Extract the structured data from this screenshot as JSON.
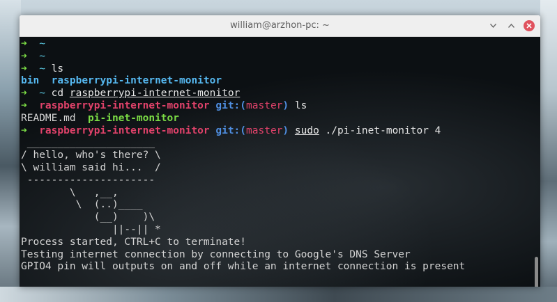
{
  "window": {
    "title": "william@arzhon-pc: ~",
    "controls": {
      "minimize_icon": "chevron-down",
      "maximize_icon": "chevron-up",
      "close_icon": "x"
    }
  },
  "colors": {
    "arrow": "#7bdc45",
    "path": "#5ac8e0",
    "directory": "#56b8f0",
    "executable": "#7bdc45",
    "repo": "#e0426a",
    "git": "#4f8ee0",
    "text": "#d4d4d4",
    "close_button": "#e0525e"
  },
  "terminal": {
    "lines": [
      {
        "segments": [
          {
            "t": "➜  ",
            "c": "arrow"
          },
          {
            "t": "~",
            "c": "tilde"
          }
        ]
      },
      {
        "segments": [
          {
            "t": "➜  ",
            "c": "arrow"
          },
          {
            "t": "~",
            "c": "tilde"
          }
        ]
      },
      {
        "segments": [
          {
            "t": "➜  ",
            "c": "arrow"
          },
          {
            "t": "~",
            "c": "tilde"
          },
          {
            "t": " ls",
            "c": "cmd"
          }
        ]
      },
      {
        "segments": [
          {
            "t": "bin",
            "c": "dir"
          },
          {
            "t": "  ",
            "c": "plain"
          },
          {
            "t": "raspberrypi-internet-monitor",
            "c": "dir"
          }
        ]
      },
      {
        "segments": [
          {
            "t": "➜  ",
            "c": "arrow"
          },
          {
            "t": "~",
            "c": "tilde"
          },
          {
            "t": " cd ",
            "c": "cmd"
          },
          {
            "t": "raspberrypi-internet-monitor",
            "c": "cmd ul"
          }
        ]
      },
      {
        "segments": [
          {
            "t": "➜  ",
            "c": "arrow"
          },
          {
            "t": "raspberrypi-internet-monitor",
            "c": "repo"
          },
          {
            "t": " git:(",
            "c": "git"
          },
          {
            "t": "master",
            "c": "branch"
          },
          {
            "t": ")",
            "c": "git"
          },
          {
            "t": " ls",
            "c": "cmd"
          }
        ]
      },
      {
        "segments": [
          {
            "t": "README.md",
            "c": "plain"
          },
          {
            "t": "  ",
            "c": "plain"
          },
          {
            "t": "pi-inet-monitor",
            "c": "exec"
          }
        ]
      },
      {
        "segments": [
          {
            "t": "➜  ",
            "c": "arrow"
          },
          {
            "t": "raspberrypi-internet-monitor",
            "c": "repo"
          },
          {
            "t": " git:(",
            "c": "git"
          },
          {
            "t": "master",
            "c": "branch"
          },
          {
            "t": ")",
            "c": "git"
          },
          {
            "t": " ",
            "c": "cmd"
          },
          {
            "t": "sudo",
            "c": "cmd ul"
          },
          {
            "t": " ./pi-inet-monitor 4",
            "c": "cmd"
          }
        ]
      },
      {
        "segments": [
          {
            "t": " _____________________",
            "c": "plain"
          }
        ]
      },
      {
        "segments": [
          {
            "t": "/ hello, who's there? \\",
            "c": "plain"
          }
        ]
      },
      {
        "segments": [
          {
            "t": "\\ william said hi...  /",
            "c": "plain"
          }
        ]
      },
      {
        "segments": [
          {
            "t": " ---------------------",
            "c": "plain"
          }
        ]
      },
      {
        "segments": [
          {
            "t": "        \\   ,__,",
            "c": "plain"
          }
        ]
      },
      {
        "segments": [
          {
            "t": "         \\  (..)____",
            "c": "plain"
          }
        ]
      },
      {
        "segments": [
          {
            "t": "            (__)    )\\",
            "c": "plain"
          }
        ]
      },
      {
        "segments": [
          {
            "t": "               ||--|| *",
            "c": "plain"
          }
        ]
      },
      {
        "segments": [
          {
            "t": "Process started, CTRL+C to terminate!",
            "c": "plain"
          }
        ]
      },
      {
        "segments": [
          {
            "t": "Testing internet connection by connecting to Google's DNS Server",
            "c": "plain"
          }
        ]
      },
      {
        "segments": [
          {
            "t": "GPIO4 pin will outputs on and off while an internet connection is present",
            "c": "plain"
          }
        ]
      }
    ]
  }
}
